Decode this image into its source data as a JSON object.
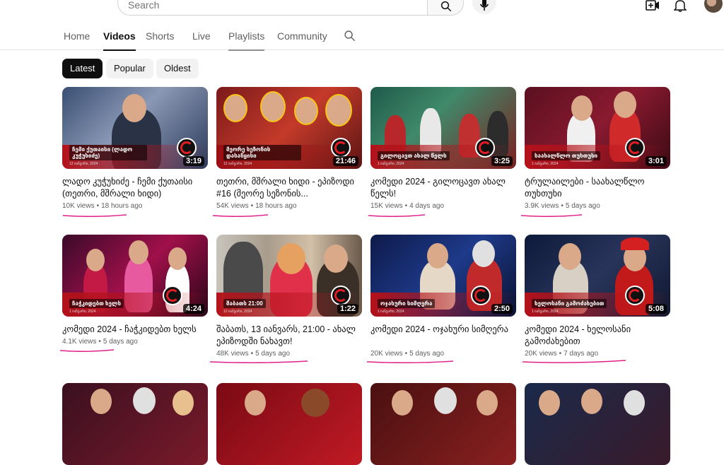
{
  "header": {
    "search_placeholder": "Search",
    "icons": [
      "search-icon",
      "mic-icon",
      "create-video-icon",
      "bell-icon",
      "avatar"
    ]
  },
  "tabs": [
    {
      "label": "Home"
    },
    {
      "label": "Videos"
    },
    {
      "label": "Shorts"
    },
    {
      "label": "Live"
    },
    {
      "label": "Playlists"
    },
    {
      "label": "Community"
    }
  ],
  "filters": [
    {
      "label": "Latest"
    },
    {
      "label": "Popular"
    },
    {
      "label": "Oldest"
    }
  ],
  "videos": [
    {
      "title": "ლადო კუჭუხიძე - ჩემი ქუთაისი (თეთრი, მშრალი ხიდი)",
      "views": "10K views",
      "age": "18 hours ago",
      "duration": "3:19",
      "caption": "ჩემი ქუთაისი (ლადო კუჭუხიძე)",
      "thumb_date": "12 იანვარი, 2024"
    },
    {
      "title": "თეთრი, მშრალი ხიდი - ეპიზოდი #16 (მეორე სეზონის...",
      "views": "54K views",
      "age": "18 hours ago",
      "duration": "21:46",
      "caption": "მეორე სეზონის დასაწყისი",
      "thumb_date": "12 იანვარი, 2024"
    },
    {
      "title": "კომედი 2024 - გილოცავთ ახალ წელს!",
      "views": "15K views",
      "age": "4 days ago",
      "duration": "3:25",
      "caption": "გილოცავთ ახალ წელს",
      "thumb_date": "1 იანვარი, 2024"
    },
    {
      "title": "ტრულაილები - საახალწლო თუხთუხი",
      "views": "3.9K views",
      "age": "5 days ago",
      "duration": "3:01",
      "caption": "საახალწლო თუხთუხი",
      "thumb_date": "1 იანვარი, 2024"
    },
    {
      "title": "კომედი 2024 - ჩაჭკიდებთ ხელს",
      "views": "4.1K views",
      "age": "5 days ago",
      "duration": "4:24",
      "caption": "ჩაჭკიდებთ ხელს",
      "thumb_date": "1 იანვარი, 2024"
    },
    {
      "title": "შაბათს, 13 იანვარს, 21:00 - ახალ ეპიზოდში ნახავთ!",
      "views": "48K views",
      "age": "5 days ago",
      "duration": "1:22",
      "caption": "შაბათს 21:00",
      "thumb_date": "12 იანვარი, 2024"
    },
    {
      "title": "კომედი 2024 - ოჯახური სიმღერა",
      "views": "20K views",
      "age": "5 days ago",
      "duration": "2:50",
      "caption": "ოჯახური სიმღერა",
      "thumb_date": "1 იანვარი, 2024"
    },
    {
      "title": "კომედი 2024 - ხელოსანი გამოძახებით",
      "views": "20K views",
      "age": "7 days ago",
      "duration": "5:08",
      "caption": "ხელოსანი გამოძახებით",
      "thumb_date": "1 იანვარი, 2024"
    }
  ],
  "colors": {
    "annotation_underline": "#e0218a",
    "logo_red": "#e21e25"
  }
}
